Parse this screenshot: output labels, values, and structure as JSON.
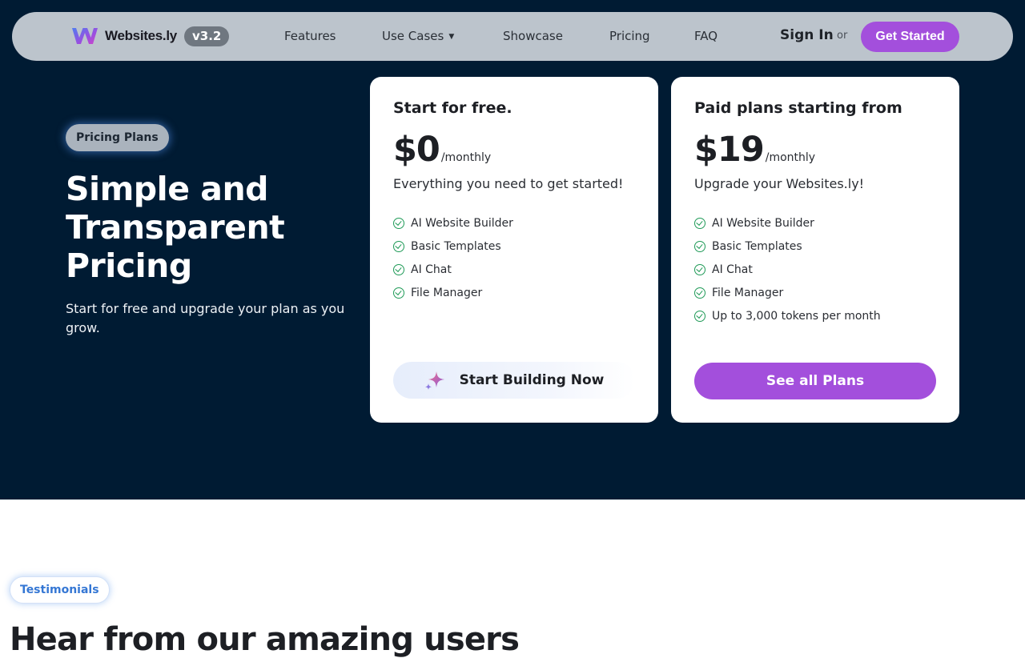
{
  "nav": {
    "logo_text": "Websites.ly",
    "version": "v3.2",
    "links": [
      "Features",
      "Use Cases",
      "Showcase",
      "Pricing",
      "FAQ"
    ],
    "sign_in": "Sign In",
    "or": "or",
    "get_started": "Get Started"
  },
  "hero": {
    "badge": "Pricing Plans",
    "title": "Simple and Transparent Pricing",
    "subtitle": "Start for free and upgrade your plan as you grow."
  },
  "free_plan": {
    "heading": "Start for free.",
    "price": "$0",
    "period": "/monthly",
    "description": "Everything you need to get started!",
    "features": [
      "AI Website Builder",
      "Basic Templates",
      "AI Chat",
      "File Manager"
    ],
    "cta": "Start Building Now"
  },
  "paid_plan": {
    "heading": "Paid plans starting from",
    "price": "$19",
    "period": "/monthly",
    "description": "Upgrade your Websites.ly!",
    "features": [
      "AI Website Builder",
      "Basic Templates",
      "AI Chat",
      "File Manager",
      "Up to 3,000 tokens per month"
    ],
    "cta": "See all Plans"
  },
  "testimonials": {
    "badge": "Testimonials",
    "title": "Hear from our amazing users"
  },
  "colors": {
    "hero_bg": "#001b33",
    "accent": "#a34fdc",
    "check": "#1f9a57"
  }
}
